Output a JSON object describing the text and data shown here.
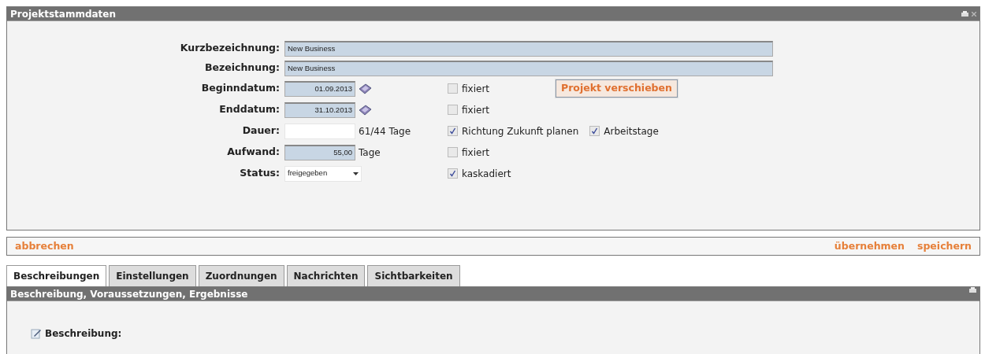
{
  "panel": {
    "title": "Projektstammdaten"
  },
  "rows": [
    {
      "label": "Kurzbezeichnung:",
      "field": {
        "kind": "text",
        "value": "New Business",
        "shaded": true
      }
    },
    {
      "label": "Bezeichnung:",
      "field": {
        "kind": "text",
        "value": "New Business",
        "shaded": true
      }
    },
    {
      "label": "Beginndatum:",
      "field": {
        "kind": "date",
        "value": "01.09.2013",
        "shaded": true
      },
      "options": [
        {
          "label": "fixiert",
          "checked": false
        }
      ],
      "button": "Projekt verschieben"
    },
    {
      "label": "Enddatum:",
      "field": {
        "kind": "date",
        "value": "31.10.2013",
        "shaded": true
      },
      "options": [
        {
          "label": "fixiert",
          "checked": false
        }
      ]
    },
    {
      "label": "Dauer:",
      "field": {
        "kind": "number",
        "shaded": false,
        "suffix": "61/44 Tage"
      },
      "options": [
        {
          "label": "Richtung Zukunft planen",
          "checked": true
        },
        {
          "label": "Arbeitstage",
          "checked": true
        }
      ]
    },
    {
      "label": "Aufwand:",
      "field": {
        "kind": "number",
        "value": "55,00",
        "shaded": true,
        "suffix": "Tage"
      },
      "options": [
        {
          "label": "fixiert",
          "checked": false
        }
      ]
    },
    {
      "label": "Status:",
      "field": {
        "kind": "select",
        "value": "freigegeben",
        "shaded": false
      },
      "options": [
        {
          "label": "kaskadiert",
          "checked": true
        }
      ]
    }
  ],
  "actions": {
    "left": [
      "abbrechen"
    ],
    "right": [
      "übernehmen",
      "speichern"
    ]
  },
  "tabs": [
    {
      "label": "Beschreibungen",
      "selected": true
    },
    {
      "label": "Einstellungen",
      "selected": false
    },
    {
      "label": "Zuordnungen",
      "selected": false
    },
    {
      "label": "Nachrichten",
      "selected": false
    },
    {
      "label": "Sichtbarkeiten",
      "selected": false
    }
  ],
  "section": {
    "title": "Beschreibung, Voraussetzungen, Ergebnisse",
    "field_label": "Beschreibung:"
  }
}
